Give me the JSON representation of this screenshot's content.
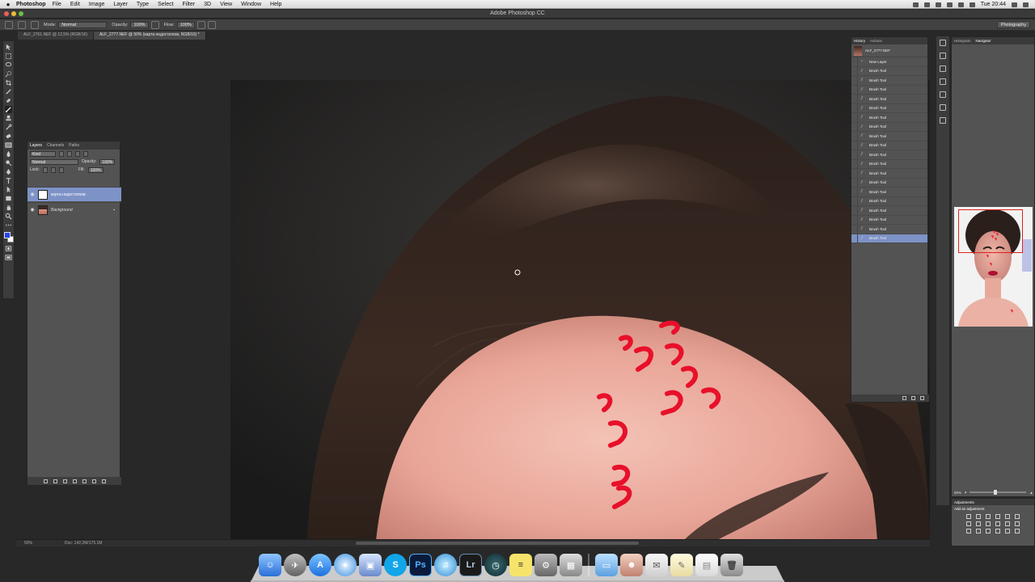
{
  "menubar": {
    "app": "Photoshop",
    "items": [
      "File",
      "Edit",
      "Image",
      "Layer",
      "Type",
      "Select",
      "Filter",
      "3D",
      "View",
      "Window",
      "Help"
    ],
    "clock": "Tue 20:44"
  },
  "window": {
    "title": "Adobe Photoshop CC"
  },
  "options": {
    "mode_label": "Mode:",
    "mode_value": "Normal",
    "opacity_label": "Opacity:",
    "opacity_value": "100%",
    "flow_label": "Flow:",
    "flow_value": "100%",
    "workspace": "Photography"
  },
  "doc_tabs": [
    "ALF_2761.NEF @ 12,5% (RGB/16)",
    "ALF_2777.NEF @ 50% (карта недостатков, RGB/16) *"
  ],
  "layers_panel": {
    "tabs": [
      "Layers",
      "Channels",
      "Paths"
    ],
    "kind_label": "Kind",
    "blend_mode": "Normal",
    "opacity_label": "Opacity:",
    "opacity_value": "100%",
    "lock_label": "Lock:",
    "fill_label": "Fill:",
    "fill_value": "100%",
    "layers": [
      {
        "name": "карта недостатков",
        "selected": true
      },
      {
        "name": "Background",
        "selected": false
      }
    ]
  },
  "history_panel": {
    "tabs": [
      "History",
      "Actions"
    ],
    "snapshot": "ALF_2777.NEF",
    "items": [
      "New Layer",
      "Brush Tool",
      "Brush Tool",
      "Brush Tool",
      "Brush Tool",
      "Brush Tool",
      "Brush Tool",
      "Brush Tool",
      "Brush Tool",
      "Brush Tool",
      "Brush Tool",
      "Brush Tool",
      "Brush Tool",
      "Brush Tool",
      "Brush Tool",
      "Brush Tool",
      "Brush Tool",
      "Brush Tool",
      "Brush Tool",
      "Brush Tool"
    ]
  },
  "navigator_panel": {
    "tabs": [
      "Histogram",
      "Navigator"
    ],
    "zoom": "50%"
  },
  "adjustments_panel": {
    "title": "Adjustments",
    "subtitle": "Add an adjustment"
  },
  "statusbar": {
    "zoom": "50%",
    "doc_info": "Doc: 142,2M/175,1M"
  },
  "dock": {
    "apps": [
      "finder-icon",
      "launchpad-icon",
      "app-store-icon",
      "safari-icon",
      "preview-icon",
      "skype-icon",
      "photoshop-icon",
      "itunes-icon",
      "lightroom-icon",
      "time-machine-icon",
      "stickies-icon",
      "system-prefs-icon",
      "photo-booth-icon",
      "folder-icon",
      "contacts-icon",
      "mail-icon",
      "notes-icon",
      "document-icon",
      "trash-icon"
    ],
    "labels": {
      "skype": "S",
      "photoshop": "Ps",
      "lightroom": "Lr"
    }
  },
  "colors": {
    "accent_selection": "#7d92c6",
    "foreground_swatch": "#2244ee",
    "paint_marks": "#e8102a"
  }
}
